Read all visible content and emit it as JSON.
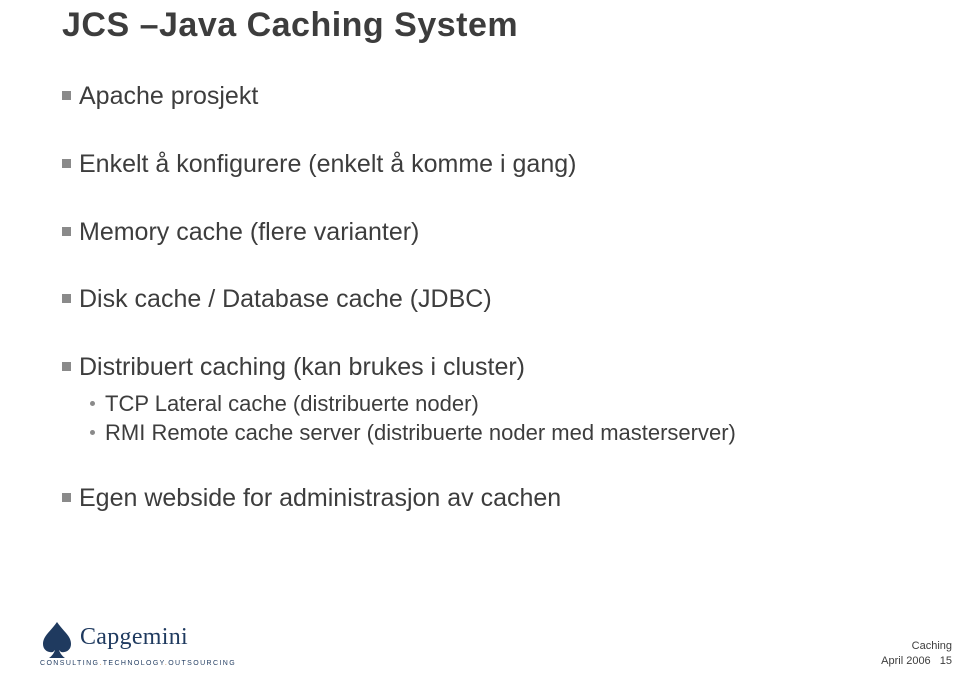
{
  "title": "JCS –Java Caching System",
  "bullets": [
    {
      "text": "Apache prosjekt"
    },
    {
      "text": "Enkelt å konfigurere (enkelt å komme i gang)"
    },
    {
      "text": "Memory cache (flere varianter)"
    },
    {
      "text": "Disk cache / Database cache (JDBC)"
    },
    {
      "text": "Distribuert caching (kan brukes i cluster)",
      "sub": [
        "TCP Lateral cache (distribuerte noder)",
        "RMI Remote cache server (distribuerte noder med masterserver)"
      ]
    },
    {
      "text": "Egen webside for administrasjon av cachen"
    }
  ],
  "logo": {
    "brand": "Capgemini",
    "tagline_parts": [
      "CONSULTING",
      "TECHNOLOGY",
      "OUTSOURCING"
    ]
  },
  "footer": {
    "label": "Caching",
    "date": "April 2006",
    "page": "15"
  }
}
